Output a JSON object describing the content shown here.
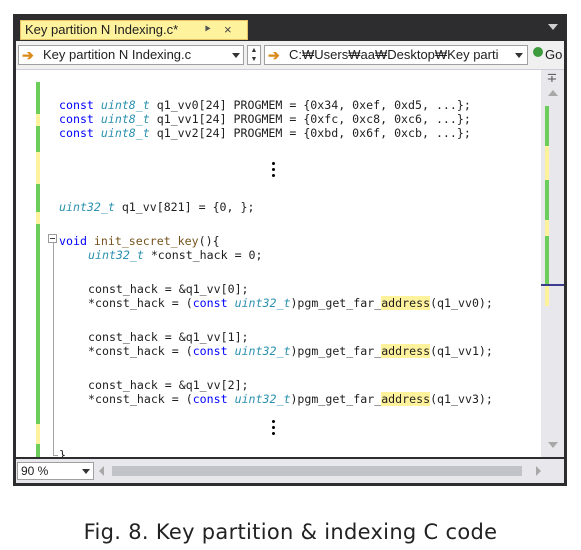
{
  "tab": {
    "title": "Key partition N Indexing.c*",
    "pin_icon": "pin-icon",
    "close_label": "×"
  },
  "nav": {
    "file_dropdown": "Key partition N Indexing.c",
    "path_dropdown": "C:₩Users₩aa₩Desktop₩Key parti",
    "go_label": "Go"
  },
  "code": {
    "line1": [
      "const ",
      "uint8_t",
      " q1_vv0[24] PROGMEM = {0x34, 0xef, 0xd5, ...};"
    ],
    "line2": [
      "const ",
      "uint8_t",
      " q1_vv1[24] PROGMEM = {0xfc, 0xc8, 0xc6, ...};"
    ],
    "line3": [
      "const ",
      "uint8_t",
      " q1_vv2[24] PROGMEM = {0xbd, 0x6f, 0xcb, ...};"
    ],
    "line4": [
      "uint32_t",
      " q1_vv[821] = {0, };"
    ],
    "line5": [
      "void ",
      "init_secret_key",
      "(){"
    ],
    "line6": [
      "uint32_t",
      " *const_hack = 0;"
    ],
    "line7": "const_hack = &q1_vv[0];",
    "line8": [
      "*const_hack = (",
      "const",
      " ",
      "uint32_t",
      ")pgm_get_far_",
      "address",
      "(q1_vv0);"
    ],
    "line9": "const_hack = &q1_vv[1];",
    "line10": [
      "*const_hack = (",
      "const",
      " ",
      "uint32_t",
      ")pgm_get_far_",
      "address",
      "(q1_vv1);"
    ],
    "line11": "const_hack = &q1_vv[2];",
    "line12": [
      "*const_hack = (",
      "const",
      " ",
      "uint32_t",
      ")pgm_get_far_",
      "address",
      "(q1_vv3);"
    ],
    "line13": "}"
  },
  "status": {
    "zoom": "90 %"
  },
  "caption": "Fig. 8. Key partition & indexing C code",
  "colors": {
    "keyword": "#0000ff",
    "type": "#2b91af",
    "change_saved": "#6ccd5b",
    "change_unsaved": "#fff29d",
    "tab_active": "#fff29d",
    "frame": "#2d2d30"
  }
}
